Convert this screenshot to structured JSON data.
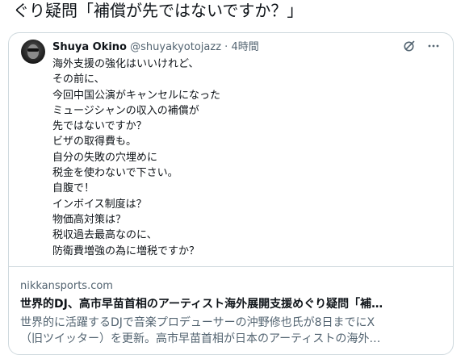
{
  "headline": {
    "text": "ぐり疑問「補償が先ではないですか？」"
  },
  "quoted_tweet": {
    "author_name": "Shuya Okino",
    "author_handle": "@shuyakyotojazz",
    "separator": "·",
    "time": "4時間",
    "lines": [
      "海外支援の強化はいいけれど、",
      "その前に、",
      "今回中国公演がキャンセルになった",
      "ミュージシャンの収入の補償が",
      "先ではないですか？",
      "ビザの取得費も。",
      "自分の失敗の穴埋めに",
      "税金を使わないで下さい。",
      "自腹で！",
      "インボイス制度は？",
      "物価高対策は？",
      "税収過去最高なのに、",
      "防衛費増強の為に増税ですか？"
    ]
  },
  "link_card": {
    "domain": "nikkansports.com",
    "title": "世界的DJ、高市早苗首相のアーティスト海外展開支援めぐり疑問「補…",
    "description_line1": "世界的に活躍するDJで音楽プロデューサーの沖野修也氏が8日までにX",
    "description_line2": "（旧ツイッター）を更新。高市早苗首相が日本のアーティストの海外…"
  },
  "icons": {
    "grok": "grok-icon",
    "more": "more-options-icon"
  },
  "colors": {
    "text_primary": "#0f1419",
    "text_secondary": "#536471",
    "border": "#cfd9de"
  }
}
